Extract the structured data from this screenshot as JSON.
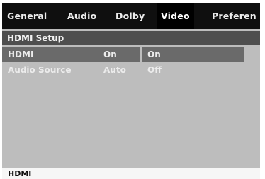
{
  "tabs": [
    {
      "label": "General"
    },
    {
      "label": "Audio"
    },
    {
      "label": "Dolby"
    },
    {
      "label": "Video"
    },
    {
      "label": "Preferen"
    }
  ],
  "active_tab": "Video",
  "section": {
    "title": "HDMI Setup"
  },
  "rows": [
    {
      "label": "HDMI",
      "value": "On"
    },
    {
      "label": "Audio Source",
      "value": "Auto"
    }
  ],
  "options": [
    {
      "label": "On"
    },
    {
      "label": "Off"
    }
  ],
  "footer": {
    "text": "HDMI"
  },
  "colors": {
    "tab_bar": "#0f0f0f",
    "section_header": "#4e4e4e",
    "panel": "#bdbdbd",
    "selection": "#6a6a6a",
    "footer": "#f6f6f6"
  }
}
